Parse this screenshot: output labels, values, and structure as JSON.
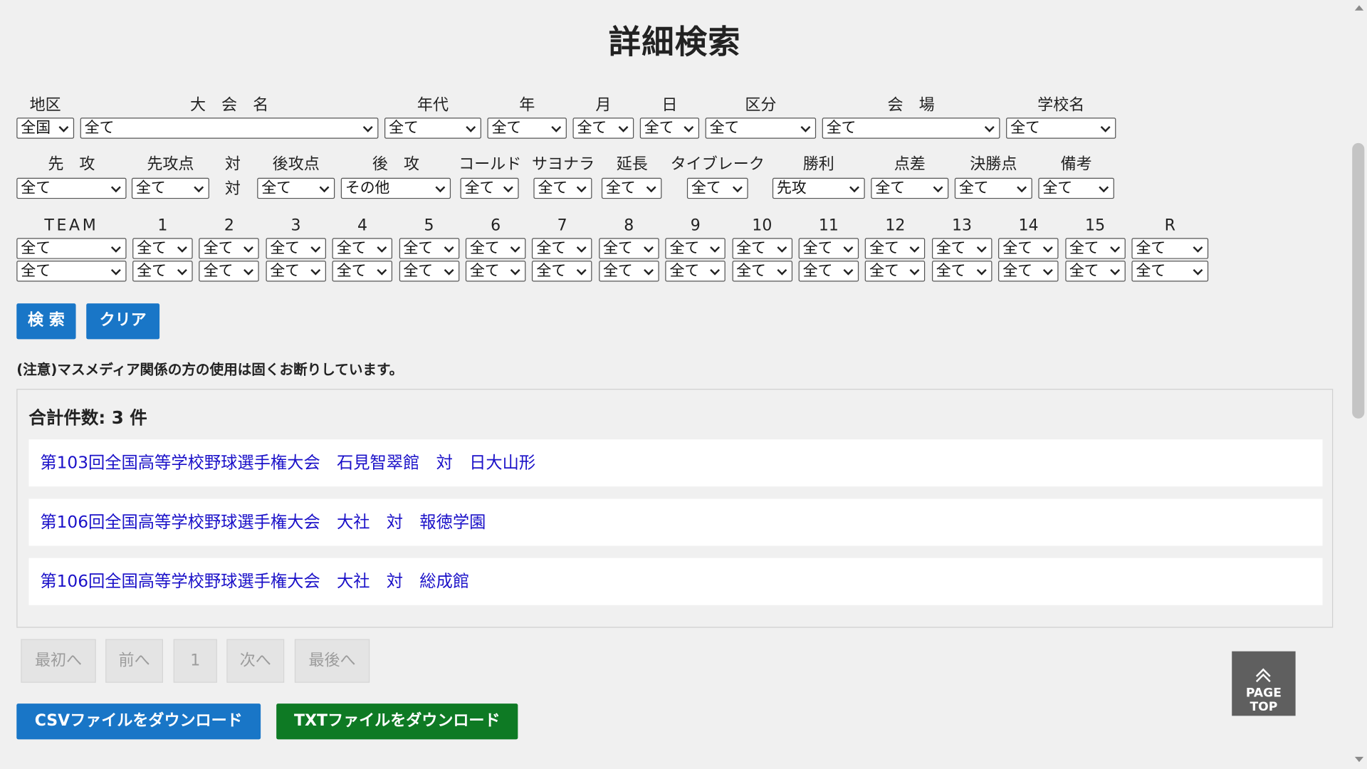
{
  "title": "詳細検索",
  "filters_row1": {
    "labels": {
      "region": "地区",
      "tournament": "大　会　名",
      "era": "年代",
      "year": "年",
      "month": "月",
      "day": "日",
      "category": "区分",
      "venue": "会　場",
      "school": "学校名"
    },
    "values": {
      "region": "全国",
      "tournament": "全て",
      "era": "全て",
      "year": "全て",
      "month": "全て",
      "day": "全て",
      "category": "全て",
      "venue": "全て",
      "school": "全て"
    }
  },
  "filters_row2": {
    "labels": {
      "first_attack": "先　攻",
      "first_score": "先攻点",
      "vs_top": "対",
      "vs_bottom": "対",
      "second_score": "後攻点",
      "second_attack": "後　攻",
      "called": "コールド",
      "sayonara": "サヨナラ",
      "extra": "延長",
      "tiebreak": "タイブレーク",
      "win": "勝利",
      "diff": "点差",
      "decisive": "決勝点",
      "remarks": "備考"
    },
    "values": {
      "first_attack": "全て",
      "first_score": "全て",
      "second_score": "全て",
      "second_attack": "その他",
      "called": "全て",
      "sayonara": "全て",
      "extra": "全て",
      "tiebreak": "全て",
      "win": "先攻",
      "diff": "全て",
      "decisive": "全て",
      "remarks": "全て"
    }
  },
  "innings": {
    "team_label": "TEAM",
    "labels": [
      "1",
      "2",
      "3",
      "4",
      "5",
      "6",
      "7",
      "8",
      "9",
      "10",
      "11",
      "12",
      "13",
      "14",
      "15",
      "R"
    ],
    "team_values": [
      "全て",
      "全て"
    ],
    "row_top_values": [
      "全て",
      "全て",
      "全て",
      "全て",
      "全て",
      "全て",
      "全て",
      "全て",
      "全て",
      "全て",
      "全て",
      "全て",
      "全て",
      "全て",
      "全て",
      "全て"
    ],
    "row_bottom_values": [
      "全て",
      "全て",
      "全て",
      "全て",
      "全て",
      "全て",
      "全て",
      "全て",
      "全て",
      "全て",
      "全て",
      "全て",
      "全て",
      "全て",
      "全て",
      "全て"
    ]
  },
  "actions": {
    "search": "検 索",
    "clear": "クリア"
  },
  "notice": "(注意)マスメディア関係の方の使用は固くお断りしています。",
  "results": {
    "count_label": "合計件数: 3 件",
    "items": [
      "第103回全国高等学校野球選手権大会　石見智翠館　対　日大山形",
      "第106回全国高等学校野球選手権大会　大社　対　報徳学園",
      "第106回全国高等学校野球選手権大会　大社　対　総成館"
    ]
  },
  "pagination": {
    "first": "最初へ",
    "prev": "前へ",
    "page": "1",
    "next": "次へ",
    "last": "最後へ"
  },
  "downloads": {
    "csv": "CSVファイルをダウンロード",
    "txt": "TXTファイルをダウンロード"
  },
  "page_top": "PAGE TOP",
  "colors": {
    "primary": "#1976c7",
    "download_txt": "#0e7a24",
    "link": "#1a10c8"
  }
}
